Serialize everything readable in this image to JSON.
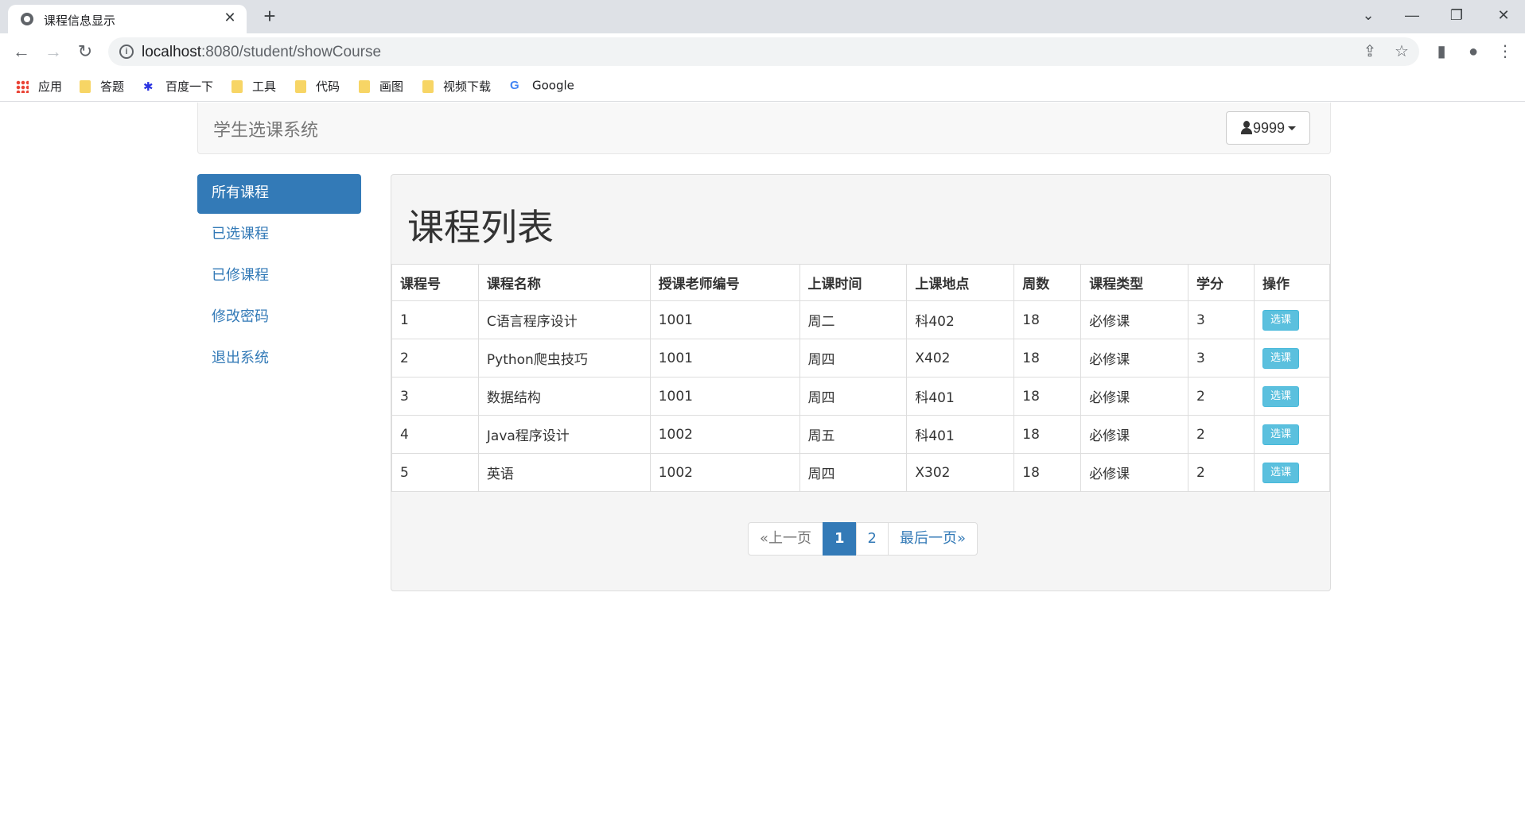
{
  "browser": {
    "tab_title": "课程信息显示",
    "url_host": "localhost",
    "url_path": ":8080/student/showCourse",
    "bookmarks": [
      "应用",
      "答题",
      "百度一下",
      "工具",
      "代码",
      "画图",
      "视频下载",
      "Google"
    ]
  },
  "navbar": {
    "brand": "学生选课系统",
    "user": "9999"
  },
  "sidebar": {
    "items": [
      "所有课程",
      "已选课程",
      "已修课程",
      "修改密码",
      "退出系统"
    ],
    "active_index": 0
  },
  "main": {
    "heading": "课程列表",
    "columns": [
      "课程号",
      "课程名称",
      "授课老师编号",
      "上课时间",
      "上课地点",
      "周数",
      "课程类型",
      "学分",
      "操作"
    ],
    "rows": [
      [
        "1",
        "C语言程序设计",
        "1001",
        "周二",
        "科402",
        "18",
        "必修课",
        "3"
      ],
      [
        "2",
        "Python爬虫技巧",
        "1001",
        "周四",
        "X402",
        "18",
        "必修课",
        "3"
      ],
      [
        "3",
        "数据结构",
        "1001",
        "周四",
        "科401",
        "18",
        "必修课",
        "2"
      ],
      [
        "4",
        "Java程序设计",
        "1002",
        "周五",
        "科401",
        "18",
        "必修课",
        "2"
      ],
      [
        "5",
        "英语",
        "1002",
        "周四",
        "X302",
        "18",
        "必修课",
        "2"
      ]
    ],
    "action_label": "选课"
  },
  "pagination": {
    "prev": "«上一页",
    "pages": [
      "1",
      "2"
    ],
    "current": "1",
    "last": "最后一页»"
  },
  "colors": {
    "primary": "#337ab7",
    "info_button": "#5bc0de"
  }
}
